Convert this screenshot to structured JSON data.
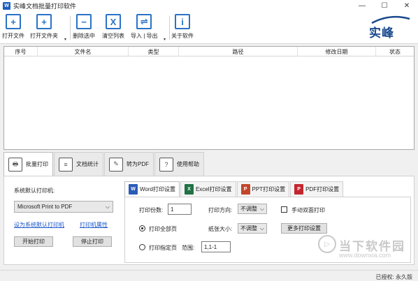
{
  "window": {
    "title": "实峰文档批量打印软件",
    "app_icon_glyph": "W",
    "minimize_glyph": "—",
    "maximize_glyph": "☐",
    "close_glyph": "✕"
  },
  "toolbar": {
    "open_file": "打开文件",
    "open_folder": "打开文件夹",
    "remove_selected": "删除选中",
    "clear_list": "清空列表",
    "import_export": "导入 | 导出",
    "about": "关于软件",
    "open_file_glyph": "+",
    "open_folder_glyph": "+",
    "remove_glyph": "−",
    "clear_glyph": "X",
    "import_glyph": "⇌",
    "about_glyph": "i",
    "caret_glyph": "▾"
  },
  "logo": {
    "text": "实峰"
  },
  "file_table": {
    "columns": [
      "序号",
      "文件名",
      "类型",
      "路径",
      "修改日期",
      "状态"
    ],
    "rows": []
  },
  "main_tabs": [
    {
      "label": "批量打印",
      "icon": "printer-icon",
      "glyph": "🖶"
    },
    {
      "label": "文档统计",
      "icon": "document-stats-icon",
      "glyph": "≡"
    },
    {
      "label": "转为PDF",
      "icon": "convert-pdf-icon",
      "glyph": "✎"
    },
    {
      "label": "使用帮助",
      "icon": "help-icon",
      "glyph": "?"
    }
  ],
  "printer": {
    "label": "系统默认打印机:",
    "selected": "Microsoft Print to PDF",
    "set_default_link": "设为系统默认打印机",
    "properties_link": "打印机属性",
    "start_button": "开始打印",
    "stop_button": "停止打印",
    "select_arrow": "⌵"
  },
  "sub_tabs": [
    {
      "label": "Word打印设置",
      "icon_letter": "W",
      "color": "#2b5bb7"
    },
    {
      "label": "Excel打印设置",
      "icon_letter": "X",
      "color": "#207245"
    },
    {
      "label": "PPT打印设置",
      "icon_letter": "P",
      "color": "#c4462a"
    },
    {
      "label": "PDF打印设置",
      "icon_letter": "P",
      "color": "#c4262e"
    }
  ],
  "word_settings": {
    "copies_label": "打印份数:",
    "copies_value": "1",
    "direction_label": "打印方向:",
    "direction_value": "不调整",
    "duplex_label": "手动双面打印",
    "print_all_label": "打印全部页",
    "paper_label": "纸张大小:",
    "paper_value": "不调整",
    "more_settings": "更多打印设置",
    "print_pages_label": "打印指定页",
    "range_label": "范围:",
    "range_value": "1,1-1",
    "select_arrow": "⌵"
  },
  "status": {
    "text": "已授权: 永久版"
  },
  "watermark": {
    "text": "当下软件园",
    "url": "www.downxia.com",
    "glyph": "▷"
  }
}
